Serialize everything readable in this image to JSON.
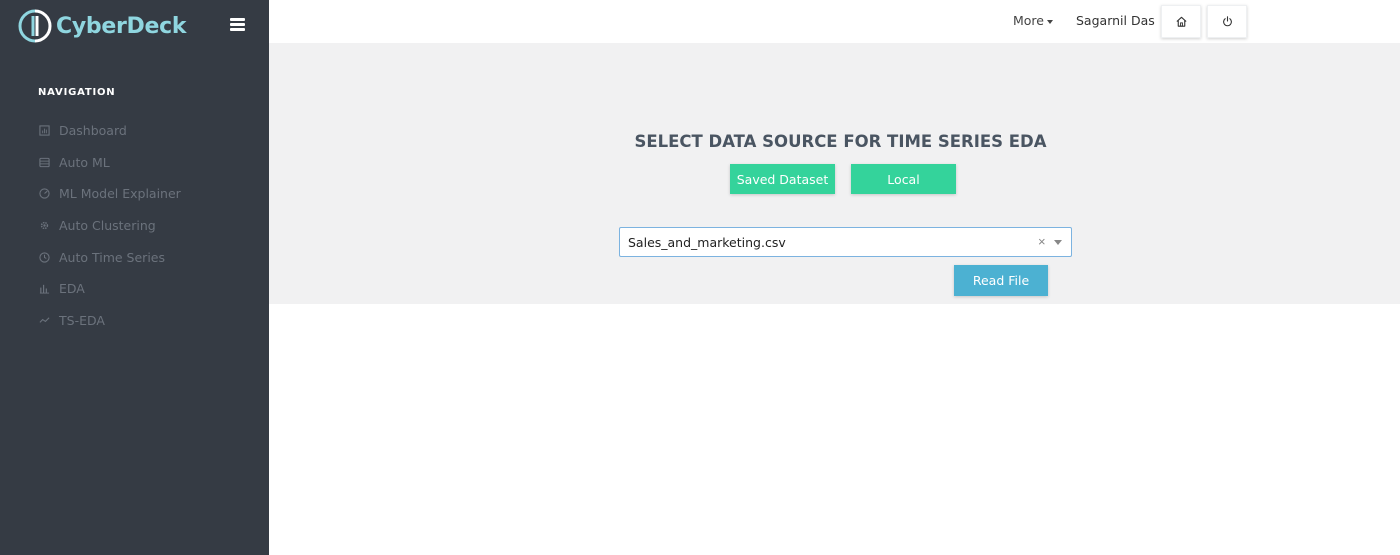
{
  "app": {
    "name": "CyberDeck",
    "brand_color": "#8fd6e0",
    "sidebar_bg": "#353b44"
  },
  "sidebar": {
    "nav_title": "NAVIGATION",
    "items": [
      {
        "label": "Dashboard",
        "icon": "dashboard-icon"
      },
      {
        "label": "Auto ML",
        "icon": "database-icon"
      },
      {
        "label": "ML Model Explainer",
        "icon": "gauge-icon"
      },
      {
        "label": "Auto Clustering",
        "icon": "gear-icon"
      },
      {
        "label": "Auto Time Series",
        "icon": "clock-icon"
      },
      {
        "label": "EDA",
        "icon": "bar-chart-icon"
      },
      {
        "label": "TS-EDA",
        "icon": "line-chart-icon"
      }
    ]
  },
  "topbar": {
    "more_label": "More",
    "user_name": "Sagarnil Das",
    "home_icon": "home-icon",
    "power_icon": "power-icon"
  },
  "main": {
    "heading": "SELECT DATA SOURCE FOR TIME SERIES EDA",
    "saved_dataset_label": "Saved Dataset",
    "local_label": "Local",
    "file_select_value": "Sales_and_marketing.csv",
    "read_file_label": "Read File",
    "accent_green": "#34d39b",
    "accent_blue": "#4cb1d2"
  }
}
